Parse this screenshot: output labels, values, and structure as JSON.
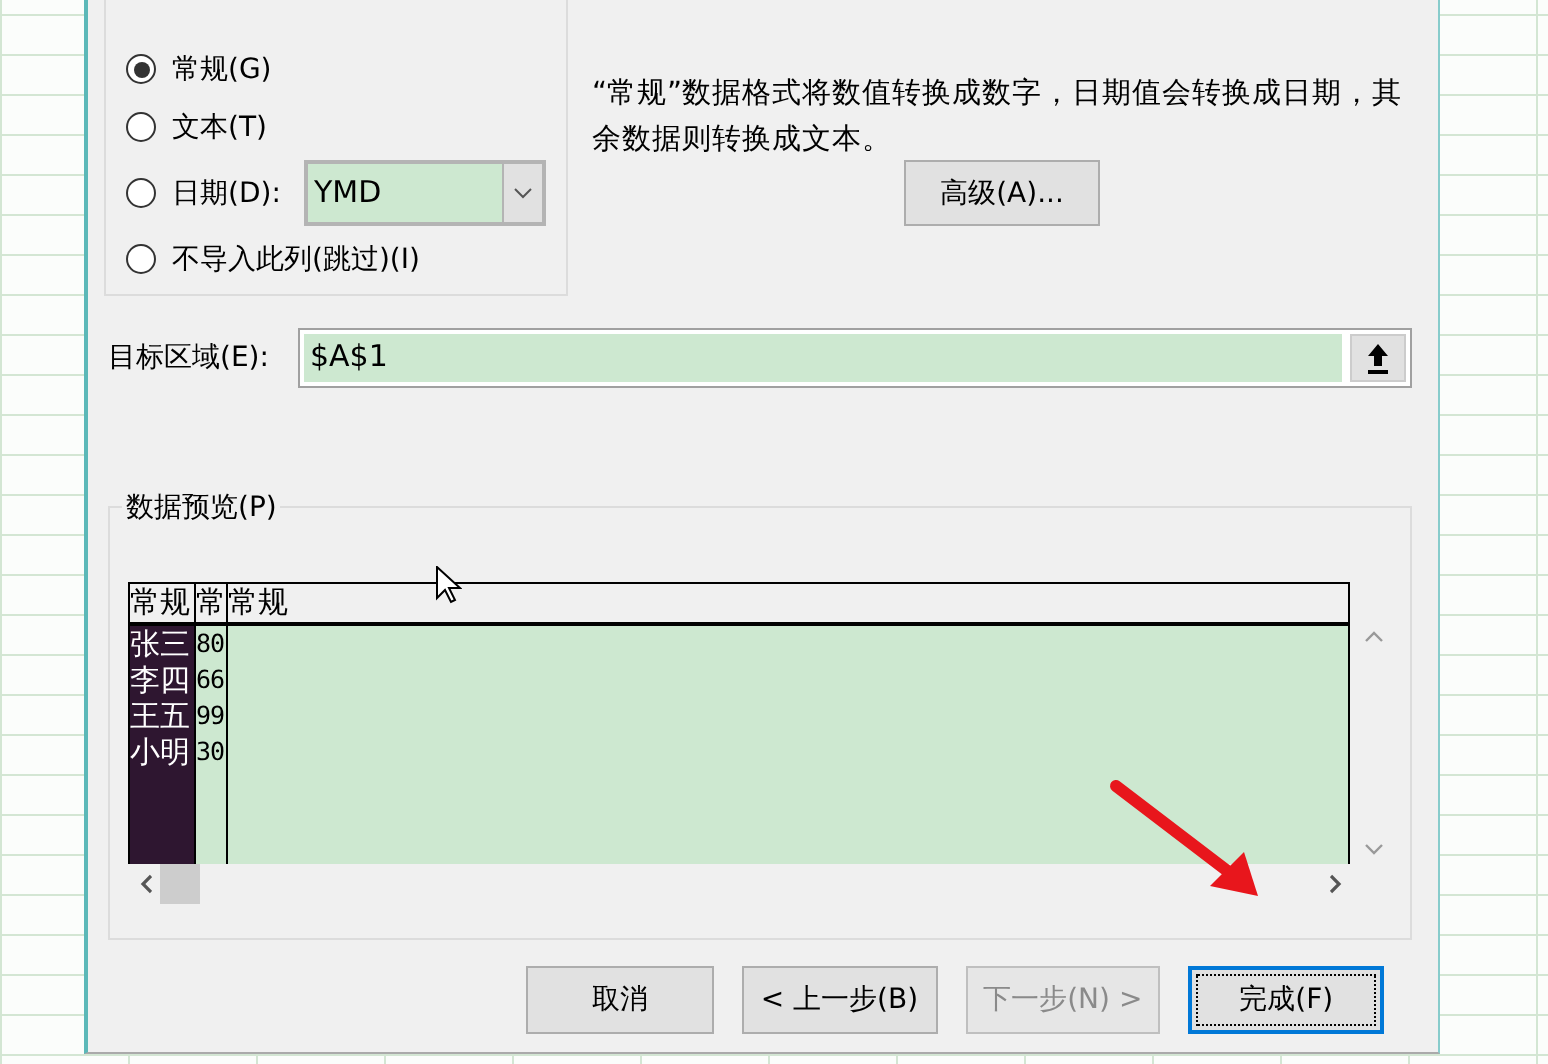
{
  "format_options": [
    {
      "label": "常规(G)",
      "selected": true,
      "kind": "plain"
    },
    {
      "label": "文本(T)",
      "selected": false,
      "kind": "plain"
    },
    {
      "label": "日期(D):",
      "selected": false,
      "kind": "date",
      "format": "YMD"
    },
    {
      "label": "不导入此列(跳过)(I)",
      "selected": false,
      "kind": "plain"
    }
  ],
  "description": "“常规”数据格式将数值转换成数字，日期值会转换成日期，其余数据则转换成文本。",
  "advanced_button": "高级(A)...",
  "destination": {
    "label": "目标区域(E):",
    "value": "$A$1"
  },
  "preview": {
    "title": "数据预览(P)",
    "columns": [
      {
        "header": "常规",
        "selected": true
      },
      {
        "header": "常",
        "selected": false
      },
      {
        "header": "常规",
        "selected": false
      }
    ],
    "rows": [
      [
        "张三",
        "80"
      ],
      [
        "李四",
        "66"
      ],
      [
        "王五",
        "99"
      ],
      [
        "小明",
        "30"
      ]
    ]
  },
  "buttons": [
    {
      "label": "取消",
      "disabled": false,
      "default": false
    },
    {
      "label": "< 上一步(B)",
      "disabled": false,
      "default": false
    },
    {
      "label": "下一步(N) >",
      "disabled": true,
      "default": false
    },
    {
      "label": "完成(F)",
      "disabled": false,
      "default": true
    }
  ]
}
